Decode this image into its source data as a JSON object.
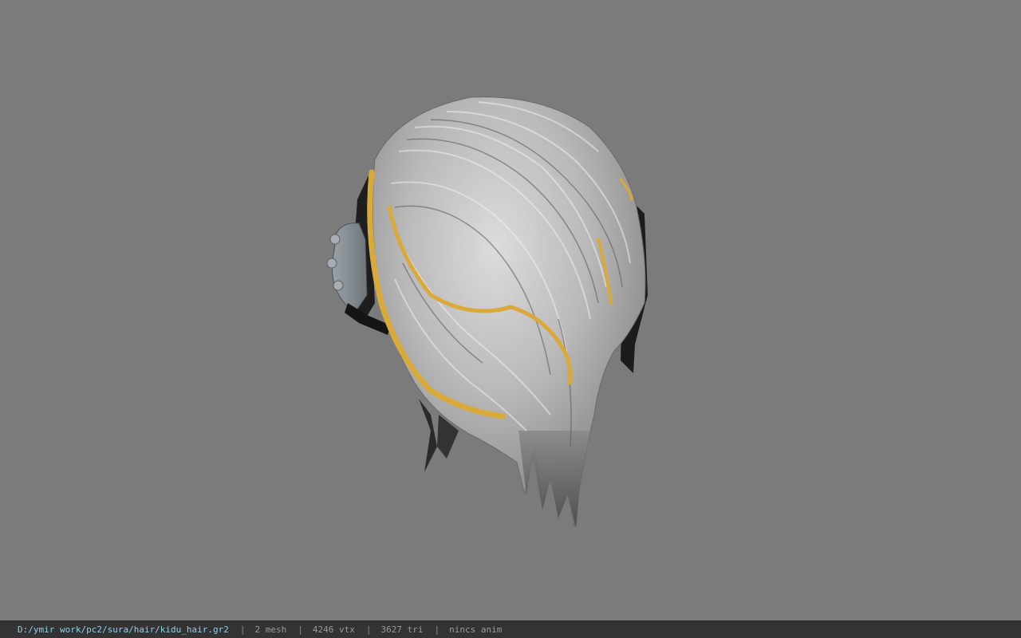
{
  "viewport": {
    "background_color": "#7b7b7b",
    "model": {
      "hair_color": "#a8a8a8",
      "streak_color": "#d9a93a",
      "accessory_color": "#8a9096"
    }
  },
  "status_bar": {
    "file_path": "D:/ymir work/pc2/sura/hair/kidu_hair.gr2",
    "separator": "|",
    "mesh_count": "2 mesh",
    "vertex_count": "4246 vtx",
    "triangle_count": "3627 tri",
    "anim_status": "nincs anim",
    "path_color": "#8fd0e8",
    "text_color": "#9a9a9a",
    "background": "#333333"
  }
}
